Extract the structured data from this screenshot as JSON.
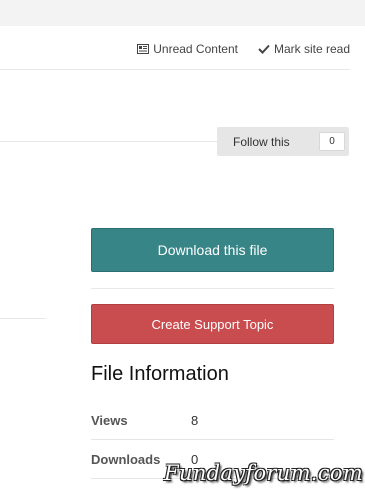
{
  "userbar": {
    "unread_label": "Unread Content",
    "mark_read_label": "Mark site read"
  },
  "follow": {
    "label": "Follow this",
    "count": "0"
  },
  "actions": {
    "download_label": "Download this file",
    "support_label": "Create Support Topic"
  },
  "file_info": {
    "heading": "File Information",
    "rows": [
      {
        "label": "Views",
        "value": "8"
      },
      {
        "label": "Downloads",
        "value": "0"
      }
    ]
  },
  "watermark": "Fundayforum.com",
  "colors": {
    "download_button": "#378587",
    "support_button": "#c94c4f",
    "follow_background": "#e6e6e6"
  },
  "icons": {
    "unread": "newspaper-icon",
    "mark_read": "check-icon"
  }
}
